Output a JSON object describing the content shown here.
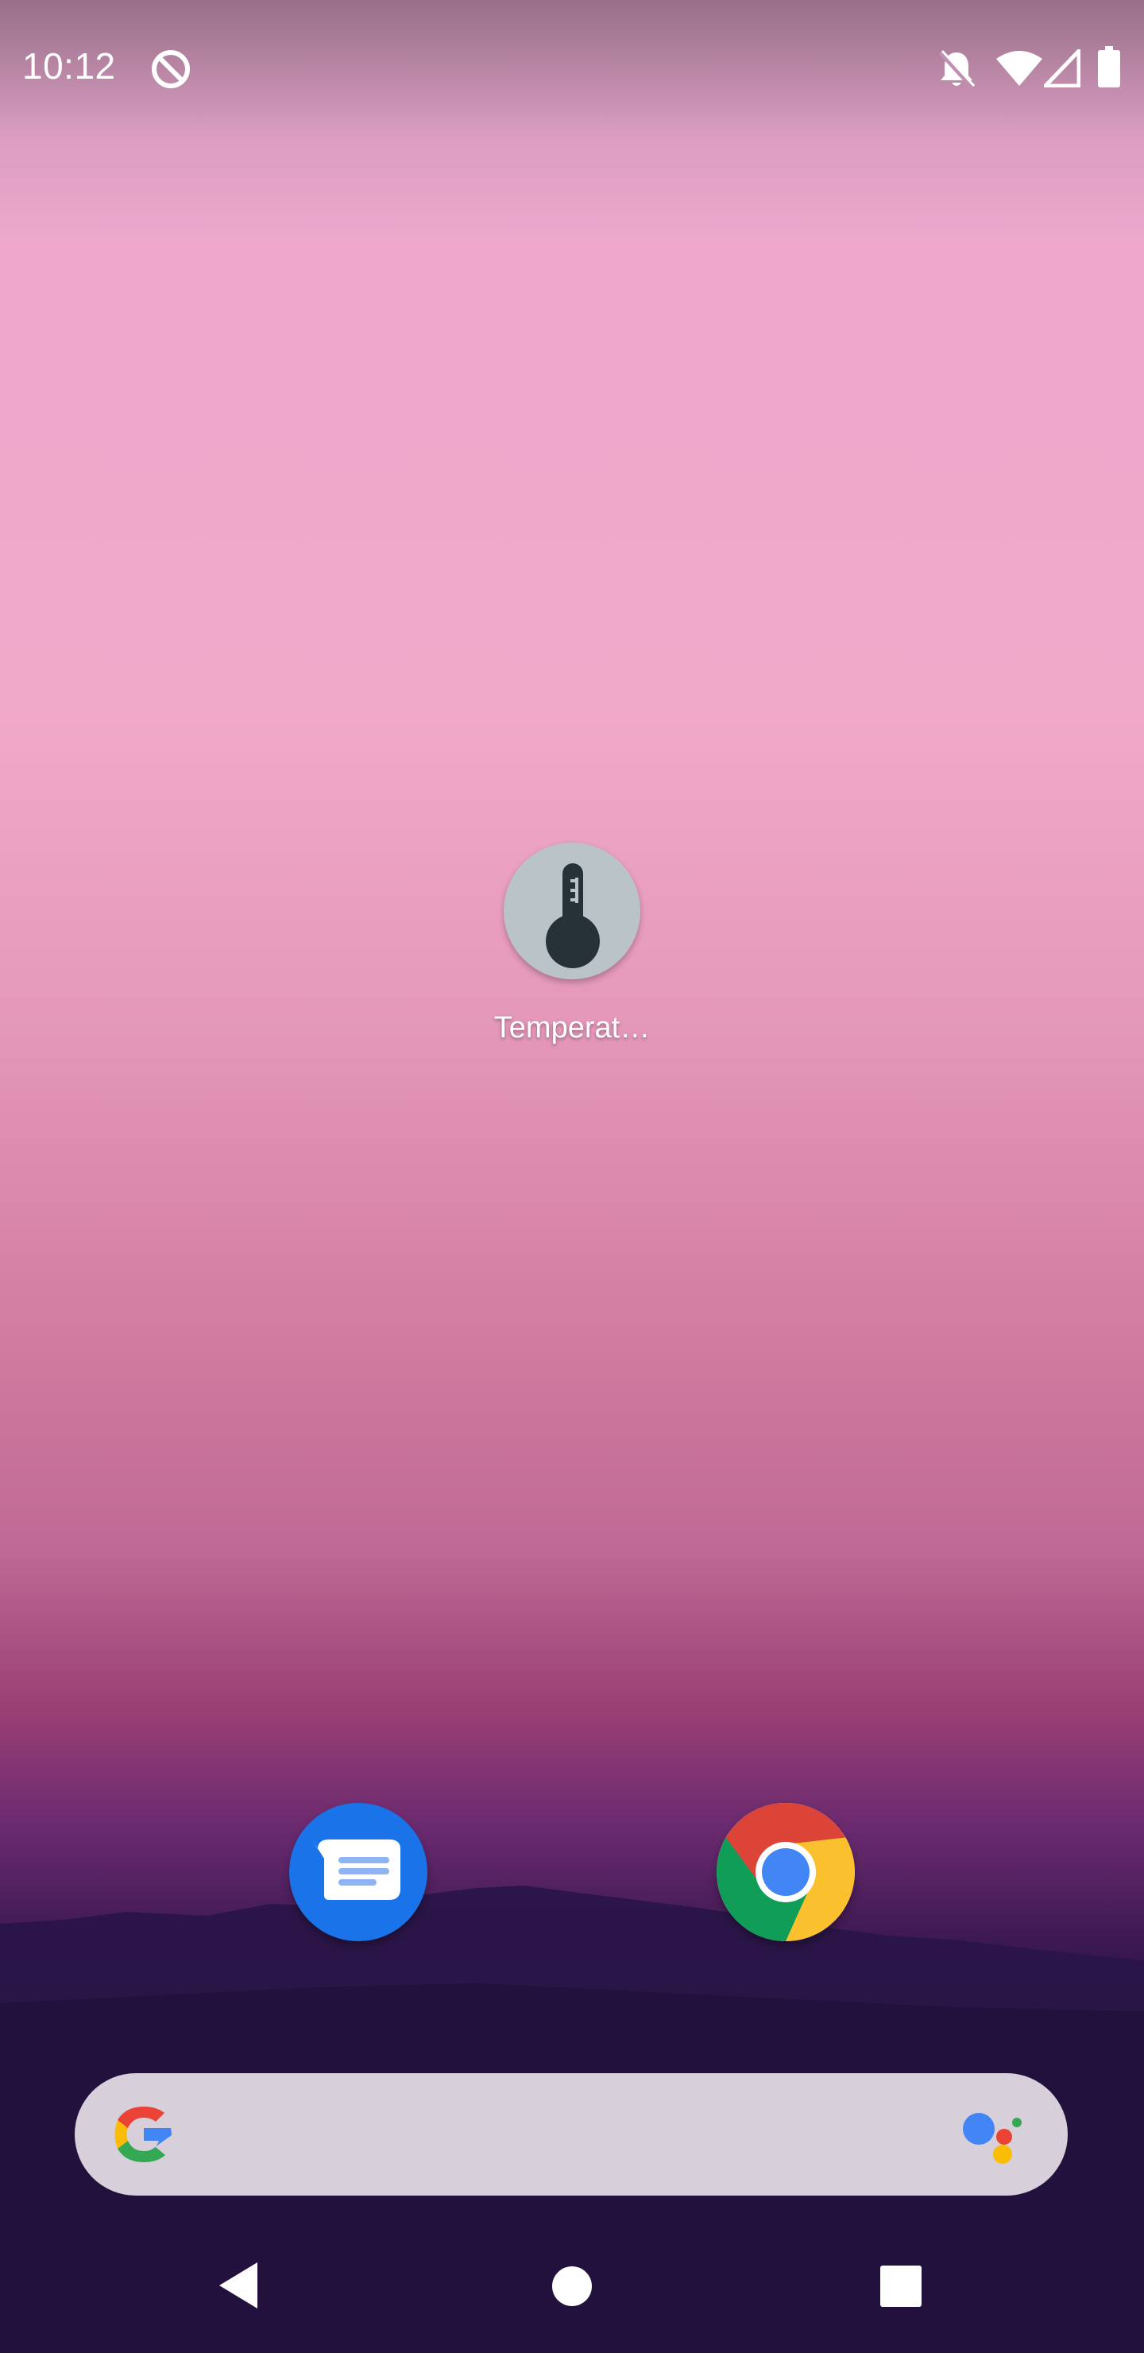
{
  "status_bar": {
    "time": "10:12",
    "icons": [
      "do-not-disturb-icon",
      "notifications-off-icon",
      "wifi-icon",
      "cell-signal-icon",
      "battery-icon"
    ]
  },
  "home": {
    "apps": [
      {
        "label": "Temperat…",
        "icon": "thermometer-icon"
      }
    ]
  },
  "dock": {
    "apps": [
      {
        "name": "messages",
        "icon": "messages-icon",
        "color": "#1a73e8"
      },
      {
        "name": "chrome",
        "icon": "chrome-icon"
      }
    ]
  },
  "search_bar": {
    "icons": [
      "google-g-icon",
      "google-assistant-icon"
    ]
  },
  "nav_bar": {
    "buttons": [
      "back",
      "home",
      "recents"
    ]
  },
  "colors": {
    "white": "#ffffff",
    "thermo_dark": "#263238",
    "messages_blue": "#1a73e8",
    "google_blue": "#4285f4",
    "google_red": "#ea4335",
    "google_yellow": "#fbbc05",
    "google_green": "#34a853"
  }
}
